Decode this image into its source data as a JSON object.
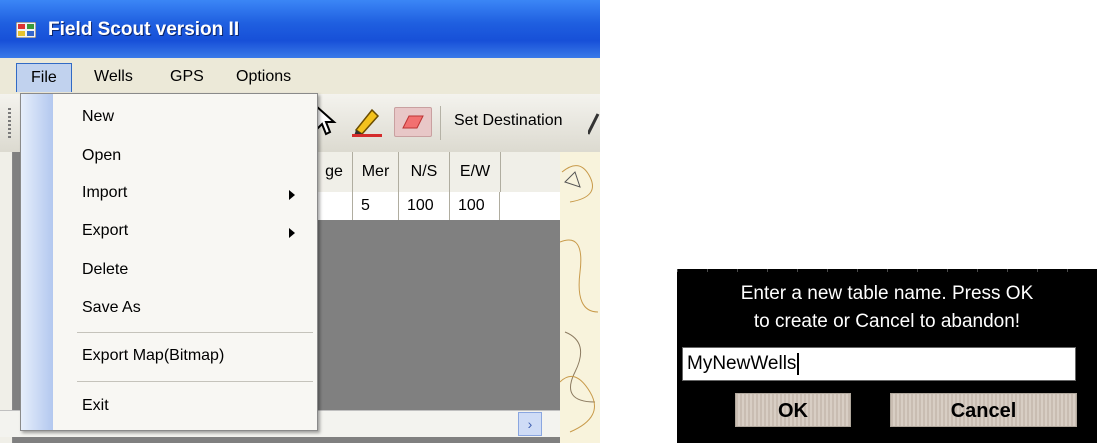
{
  "window": {
    "title": "Field Scout version II",
    "menu": [
      "File",
      "Wells",
      "GPS",
      "Options"
    ],
    "toolbar": {
      "set_destination_label": "Set Destination"
    },
    "grid": {
      "headers": [
        "ge",
        "Mer",
        "N/S",
        "E/W"
      ],
      "row": [
        "",
        "5",
        "100",
        "100"
      ]
    }
  },
  "file_menu": {
    "items": [
      {
        "label": "New"
      },
      {
        "label": "Open"
      },
      {
        "label": "Import"
      },
      {
        "label": "Export"
      },
      {
        "label": "Delete"
      },
      {
        "label": "Save As"
      },
      {
        "label": "Export Map(Bitmap)"
      },
      {
        "label": "Exit"
      }
    ]
  },
  "dialog": {
    "message_line1": "Enter a new table name.  Press OK",
    "message_line2": "to create or Cancel to abandon!",
    "input_value": "MyNewWells",
    "ok_label": "OK",
    "cancel_label": "Cancel"
  },
  "colors": {
    "titlebar": "#1f5fe0",
    "menu_gutter": "#b3c8ef",
    "dialog_bg": "#000000"
  }
}
